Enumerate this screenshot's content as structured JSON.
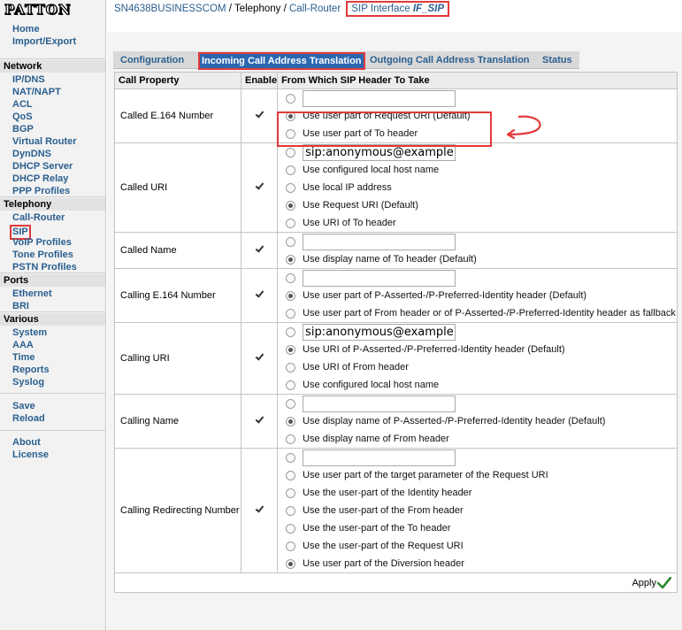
{
  "brand": {
    "logo_text": "PATTON"
  },
  "sidebar": {
    "top_links": [
      "Home",
      "Import/Export"
    ],
    "sections": [
      {
        "title": "Network",
        "items": [
          "IP/DNS",
          "NAT/NAPT",
          "ACL",
          "QoS",
          "BGP",
          "Virtual Router",
          "DynDNS",
          "DHCP Server",
          "DHCP Relay",
          "PPP Profiles"
        ]
      },
      {
        "title": "Telephony",
        "items": [
          "Call-Router",
          "SIP",
          "VoIP Profiles",
          "Tone Profiles",
          "PSTN Profiles"
        ]
      },
      {
        "title": "Ports",
        "items": [
          "Ethernet",
          "BRI"
        ]
      },
      {
        "title": "Various",
        "items": [
          "System",
          "AAA",
          "Time",
          "Reports",
          "Syslog"
        ]
      }
    ],
    "actions": [
      "Save",
      "Reload"
    ],
    "bottom_links": [
      "About",
      "License"
    ]
  },
  "breadcrumb": {
    "device": "SN4638BUSINESSCOM",
    "sep": "/",
    "telephony": "Telephony",
    "router": "Call-Router",
    "iface_prefix": "SIP Interface",
    "iface_name": "IF_SIP"
  },
  "tabs": [
    "Configuration",
    "Incoming Call Address Translation",
    "Outgoing Call Address Translation",
    "Status"
  ],
  "table": {
    "headers": [
      "Call Property",
      "Enable",
      "From Which SIP Header To Take"
    ],
    "rows": [
      {
        "property": "Called E.164 Number",
        "enabled": true,
        "options": [
          {
            "type": "input",
            "value": "",
            "selected": false
          },
          {
            "label": "Use user part of Request URI (Default)",
            "selected": true
          },
          {
            "label": "Use user part of To header",
            "selected": false
          }
        ]
      },
      {
        "property": "Called URI",
        "enabled": true,
        "options": [
          {
            "type": "input",
            "value": "sip:anonymous@example.cc",
            "selected": false
          },
          {
            "label": "Use configured local host name",
            "selected": false
          },
          {
            "label": "Use local IP address",
            "selected": false
          },
          {
            "label": "Use Request URI (Default)",
            "selected": true
          },
          {
            "label": "Use URI of To header",
            "selected": false
          }
        ]
      },
      {
        "property": "Called Name",
        "enabled": true,
        "options": [
          {
            "type": "input",
            "value": "",
            "selected": false
          },
          {
            "label": "Use display name of To header (Default)",
            "selected": true
          }
        ]
      },
      {
        "property": "Calling E.164 Number",
        "enabled": true,
        "options": [
          {
            "type": "input",
            "value": "",
            "selected": false
          },
          {
            "label": "Use user part of P-Asserted-/P-Preferred-Identity header (Default)",
            "selected": true
          },
          {
            "label": "Use user part of From header or of P-Asserted-/P-Preferred-Identity header as fallback",
            "selected": false
          }
        ]
      },
      {
        "property": "Calling URI",
        "enabled": true,
        "options": [
          {
            "type": "input",
            "value": "sip:anonymous@example.cc",
            "selected": false
          },
          {
            "label": "Use URI of P-Asserted-/P-Preferred-Identity header (Default)",
            "selected": true
          },
          {
            "label": "Use URI of From header",
            "selected": false
          },
          {
            "label": "Use configured local host name",
            "selected": false
          }
        ]
      },
      {
        "property": "Calling Name",
        "enabled": true,
        "options": [
          {
            "type": "input",
            "value": "",
            "selected": false
          },
          {
            "label": "Use display name of P-Asserted-/P-Preferred-Identity header (Default)",
            "selected": true
          },
          {
            "label": "Use display name of From header",
            "selected": false
          }
        ]
      },
      {
        "property": "Calling Redirecting Number",
        "enabled": true,
        "options": [
          {
            "type": "input",
            "value": "",
            "selected": false
          },
          {
            "label": "Use user part of the target parameter of the Request URI",
            "selected": false
          },
          {
            "label": "Use the user-part of the Identity header",
            "selected": false
          },
          {
            "label": "Use the user-part of the From header",
            "selected": false
          },
          {
            "label": "Use the user-part of the To header",
            "selected": false
          },
          {
            "label": "Use the user-part of the Request URI",
            "selected": false
          },
          {
            "label": "Use user part of the Diversion header",
            "selected": true
          }
        ]
      }
    ]
  },
  "apply_label": "Apply",
  "colors": {
    "link": "#2a5f8f",
    "active_tab": "#2b67b0",
    "annotation": "#e2393a"
  }
}
